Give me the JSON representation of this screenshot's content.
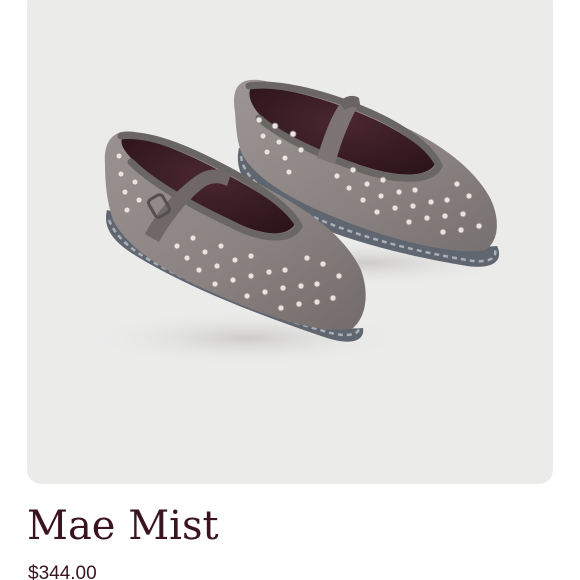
{
  "product": {
    "name": "Mae Mist",
    "price": "$344.00",
    "image_icon": "velvet-studded-mary-jane-flats",
    "colors": {
      "card_background": "#ebebea",
      "text": "#3a1420",
      "velvet": "#8f8785",
      "velvet_shadow": "#6e6664",
      "sole_trim": "#5f6670",
      "lining": "#3b1d24",
      "stud": "#e9e4df"
    }
  }
}
